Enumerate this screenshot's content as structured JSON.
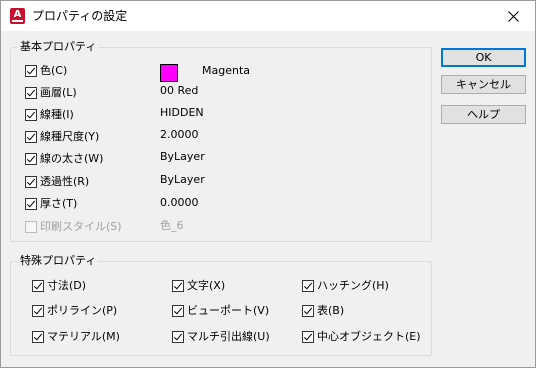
{
  "window": {
    "title": "プロパティの設定",
    "app_icon_letter": "A"
  },
  "basic": {
    "title": "基本プロパティ",
    "color_swatch": "#ff00ff",
    "items": [
      {
        "label": "色(C)",
        "value": "Magenta",
        "checked": true,
        "enabled": true
      },
      {
        "label": "画層(L)",
        "value": "00 Red",
        "checked": true,
        "enabled": true
      },
      {
        "label": "線種(I)",
        "value": "HIDDEN",
        "checked": true,
        "enabled": true
      },
      {
        "label": "線種尺度(Y)",
        "value": "2.0000",
        "checked": true,
        "enabled": true
      },
      {
        "label": "線の太さ(W)",
        "value": "ByLayer",
        "checked": true,
        "enabled": true
      },
      {
        "label": "透過性(R)",
        "value": "ByLayer",
        "checked": true,
        "enabled": true
      },
      {
        "label": "厚さ(T)",
        "value": "0.0000",
        "checked": true,
        "enabled": true
      },
      {
        "label": "印刷スタイル(S)",
        "value": "色_6",
        "checked": false,
        "enabled": false
      }
    ]
  },
  "special": {
    "title": "特殊プロパティ",
    "items": [
      {
        "label": "寸法(D)",
        "checked": true
      },
      {
        "label": "文字(X)",
        "checked": true
      },
      {
        "label": "ハッチング(H)",
        "checked": true
      },
      {
        "label": "ポリライン(P)",
        "checked": true
      },
      {
        "label": "ビューポート(V)",
        "checked": true
      },
      {
        "label": "表(B)",
        "checked": true
      },
      {
        "label": "マテリアル(M)",
        "checked": true
      },
      {
        "label": "マルチ引出線(U)",
        "checked": true
      },
      {
        "label": "中心オブジェクト(E)",
        "checked": true
      }
    ]
  },
  "buttons": {
    "ok": "OK",
    "cancel": "キャンセル",
    "help": "ヘルプ"
  }
}
